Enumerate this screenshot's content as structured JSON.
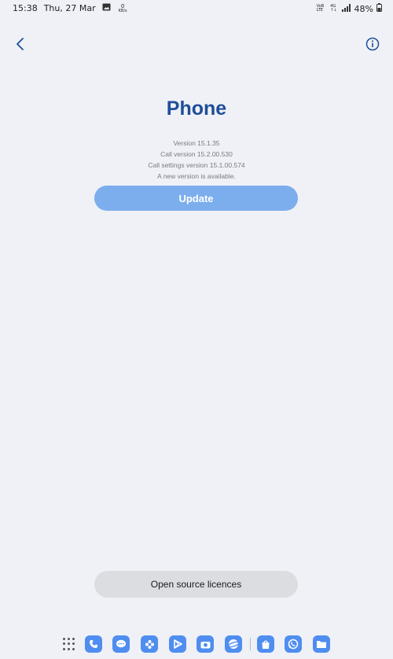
{
  "status_bar": {
    "time": "15:38",
    "date": "Thu, 27 Mar",
    "net_speed_value": "0",
    "net_speed_unit": "KB/s",
    "volte_top": "VoB",
    "volte_bottom": "LTE",
    "network_top": "4G",
    "network_bottom": "↑↓",
    "battery": "48%"
  },
  "header": {
    "back_icon": "chevron-left-icon",
    "info_icon": "info-circle-icon"
  },
  "app": {
    "title": "Phone",
    "version": "Version 15.1.35",
    "call_version": "Call version 15.2.00.530",
    "call_settings_version": "Call settings version 15.1.00.574",
    "update_notice": "A new version is available.",
    "update_button": "Update"
  },
  "footer": {
    "licences_button": "Open source licences"
  },
  "dock": {
    "items": [
      "apps-grid-icon",
      "phone-icon",
      "messages-icon",
      "gallery-icon",
      "play-store-icon",
      "camera-icon",
      "browser-icon",
      "store-icon",
      "whatsapp-icon",
      "files-icon"
    ]
  },
  "colors": {
    "background": "#eff1f6",
    "title": "#1f4e99",
    "update_button": "#7caeee",
    "licences_button": "#dcdde1",
    "dock_icon": "#4f8ef0"
  }
}
